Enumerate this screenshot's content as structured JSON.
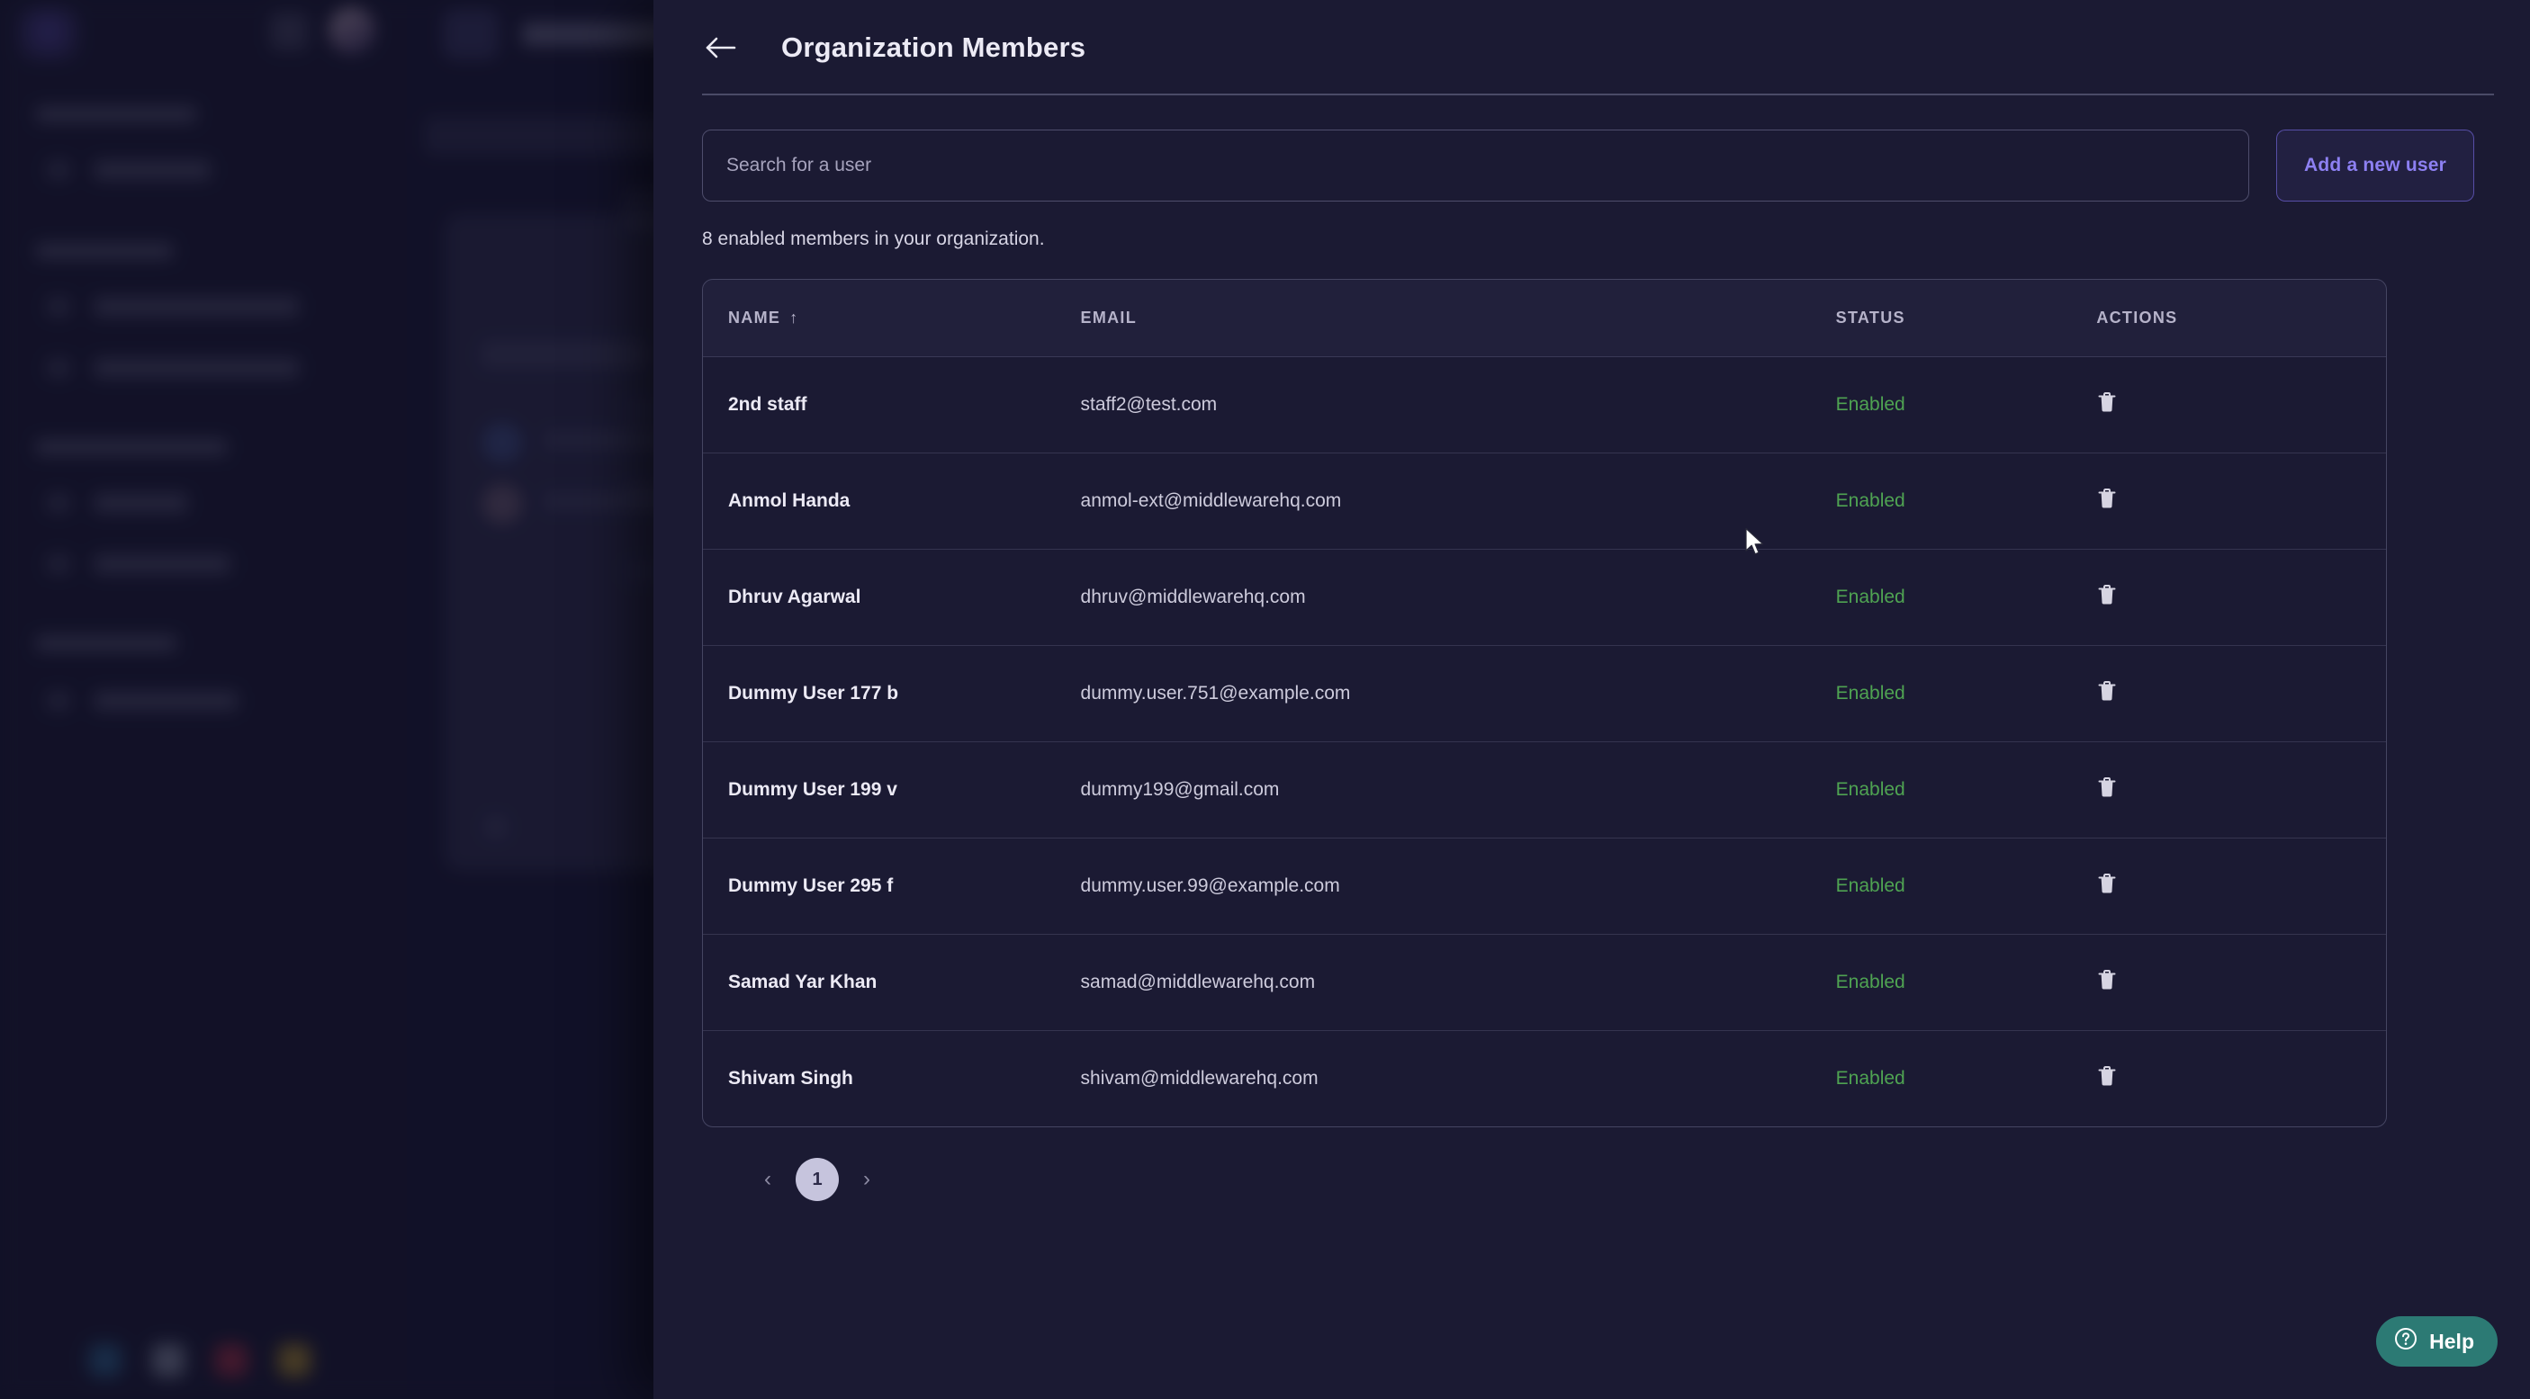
{
  "drawer": {
    "back_icon": "arrow-left-icon",
    "title": "Organization Members",
    "search": {
      "placeholder": "Search for a user",
      "value": ""
    },
    "add_user_label": "Add a new user",
    "member_count_text": "8 enabled members in your organization."
  },
  "table": {
    "columns": [
      {
        "key": "name",
        "label": "NAME",
        "sort_icon": "↑"
      },
      {
        "key": "email",
        "label": "EMAIL",
        "sort_icon": ""
      },
      {
        "key": "status",
        "label": "STATUS",
        "sort_icon": ""
      },
      {
        "key": "actions",
        "label": "ACTIONS",
        "sort_icon": ""
      }
    ],
    "rows": [
      {
        "name": "2nd staff",
        "email": "staff2@test.com",
        "status": "Enabled",
        "action_icon": "trash-icon"
      },
      {
        "name": "Anmol Handa",
        "email": "anmol-ext@middlewarehq.com",
        "status": "Enabled",
        "action_icon": "trash-icon"
      },
      {
        "name": "Dhruv Agarwal",
        "email": "dhruv@middlewarehq.com",
        "status": "Enabled",
        "action_icon": "trash-icon"
      },
      {
        "name": "Dummy User 177 b",
        "email": "dummy.user.751@example.com",
        "status": "Enabled",
        "action_icon": "trash-icon"
      },
      {
        "name": "Dummy User 199 v",
        "email": "dummy199@gmail.com",
        "status": "Enabled",
        "action_icon": "trash-icon"
      },
      {
        "name": "Dummy User 295 f",
        "email": "dummy.user.99@example.com",
        "status": "Enabled",
        "action_icon": "trash-icon"
      },
      {
        "name": "Samad Yar Khan",
        "email": "samad@middlewarehq.com",
        "status": "Enabled",
        "action_icon": "trash-icon"
      },
      {
        "name": "Shivam Singh",
        "email": "shivam@middlewarehq.com",
        "status": "Enabled",
        "action_icon": "trash-icon"
      }
    ]
  },
  "pagination": {
    "prev_label": "‹",
    "current_page": "1",
    "next_label": "›"
  },
  "help_widget": {
    "label": "Help",
    "icon": "question-circle-icon"
  },
  "colors": {
    "accent_purple": "#8d80f2",
    "status_enabled_green": "#4fa352",
    "help_teal": "#2c7a74",
    "drawer_bg": "#1b1a33",
    "page_bg": "#16162e",
    "pagination_active": "#c6c4dd"
  }
}
